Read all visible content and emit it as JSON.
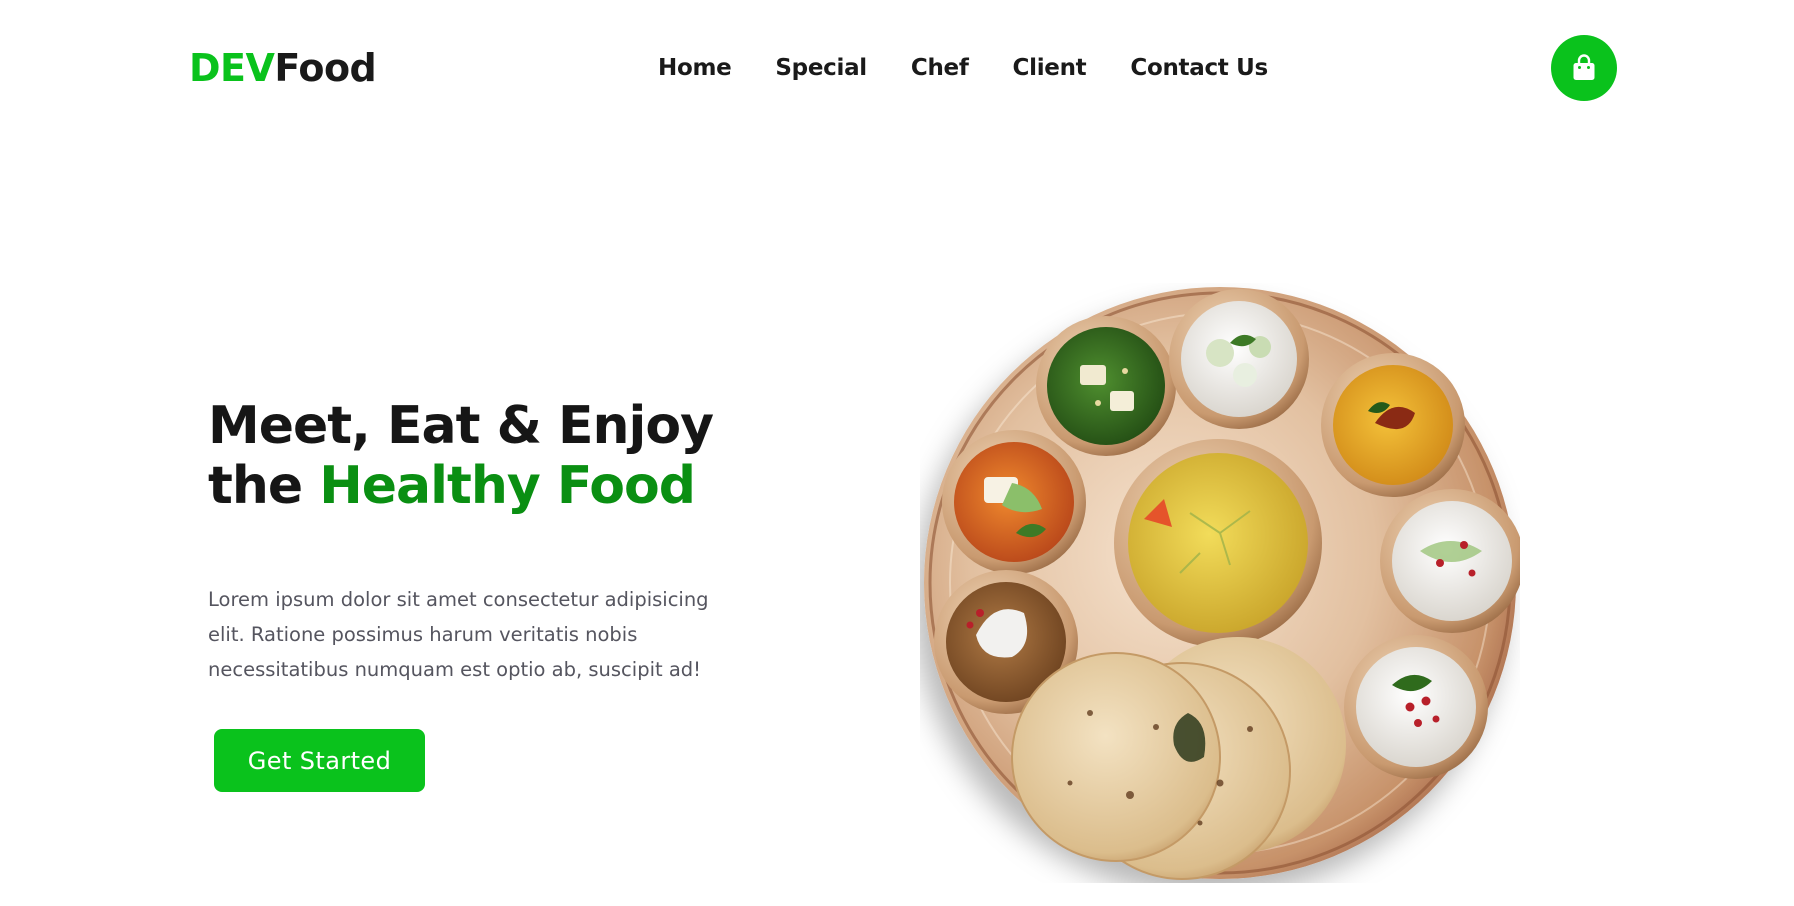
{
  "brand": {
    "accent": "DEV",
    "rest": "Food",
    "accent_color": "#0ac21c"
  },
  "nav": {
    "items": [
      {
        "label": "Home"
      },
      {
        "label": "Special"
      },
      {
        "label": "Chef"
      },
      {
        "label": "Client"
      },
      {
        "label": "Contact Us"
      }
    ]
  },
  "cart": {
    "icon": "shopping-bag-icon"
  },
  "hero": {
    "headline_line1": "Meet, Eat & Enjoy",
    "headline_prefix": "the",
    "headline_accent": "Healthy Food",
    "description": "Lorem ipsum dolor sit amet consectetur adipisicing elit. Ratione possimus harum veritatis nobis necessitatibus numquam est optio ab, suscipit ad!",
    "cta_label": "Get Started"
  },
  "colors": {
    "primary_green": "#0ac21c",
    "headline_green": "#0a8f12",
    "text_dark": "#161616",
    "text_muted": "#55555f"
  }
}
